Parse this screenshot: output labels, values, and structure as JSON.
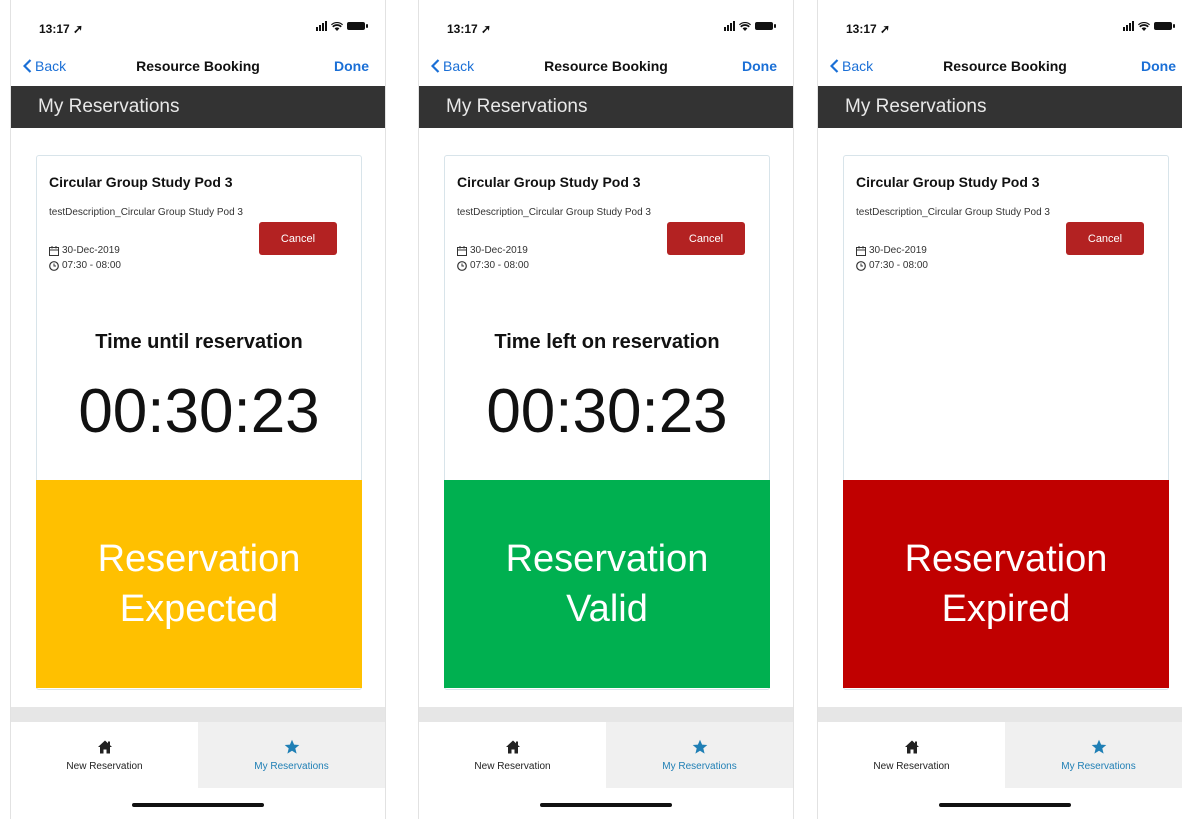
{
  "colors": {
    "header_bg": "#333333",
    "link_blue": "#1a6fd6",
    "cancel_red": "#b32222",
    "tab_active": "#1f7fb5",
    "expected": "#ffc000",
    "valid": "#00b050",
    "expired": "#c00000"
  },
  "phones": [
    {
      "status": {
        "time": "13:17 ➚"
      },
      "nav": {
        "back_label": "Back",
        "title": "Resource Booking",
        "done_label": "Done"
      },
      "section_title": "My Reservations",
      "reservation": {
        "title": "Circular Group Study Pod 3",
        "description": "testDescription_Circular Group Study Pod 3",
        "date": "30-Dec-2019",
        "time": "07:30 - 08:00",
        "cancel_label": "Cancel"
      },
      "countdown": {
        "label": "Time until reservation",
        "value": "00:30:23"
      },
      "status_box": {
        "line1": "Reservation",
        "line2": "Expected",
        "color": "#ffc000"
      },
      "tabs": {
        "new_label": "New Reservation",
        "my_label": "My Reservations"
      }
    },
    {
      "status": {
        "time": "13:17 ➚"
      },
      "nav": {
        "back_label": "Back",
        "title": "Resource Booking",
        "done_label": "Done"
      },
      "section_title": "My Reservations",
      "reservation": {
        "title": "Circular Group Study Pod 3",
        "description": "testDescription_Circular Group Study Pod 3",
        "date": "30-Dec-2019",
        "time": "07:30 - 08:00",
        "cancel_label": "Cancel"
      },
      "countdown": {
        "label": "Time left on reservation",
        "value": "00:30:23"
      },
      "status_box": {
        "line1": "Reservation",
        "line2": "Valid",
        "color": "#00b050"
      },
      "tabs": {
        "new_label": "New Reservation",
        "my_label": "My Reservations"
      }
    },
    {
      "status": {
        "time": "13:17 ➚"
      },
      "nav": {
        "back_label": "Back",
        "title": "Resource Booking",
        "done_label": "Done"
      },
      "section_title": "My Reservations",
      "reservation": {
        "title": "Circular Group Study Pod 3",
        "description": "testDescription_Circular Group Study Pod 3",
        "date": "30-Dec-2019",
        "time": "07:30 - 08:00",
        "cancel_label": "Cancel"
      },
      "countdown": {
        "label": "",
        "value": ""
      },
      "status_box": {
        "line1": "Reservation",
        "line2": "Expired",
        "color": "#c00000"
      },
      "tabs": {
        "new_label": "New Reservation",
        "my_label": "My Reservations"
      }
    }
  ]
}
